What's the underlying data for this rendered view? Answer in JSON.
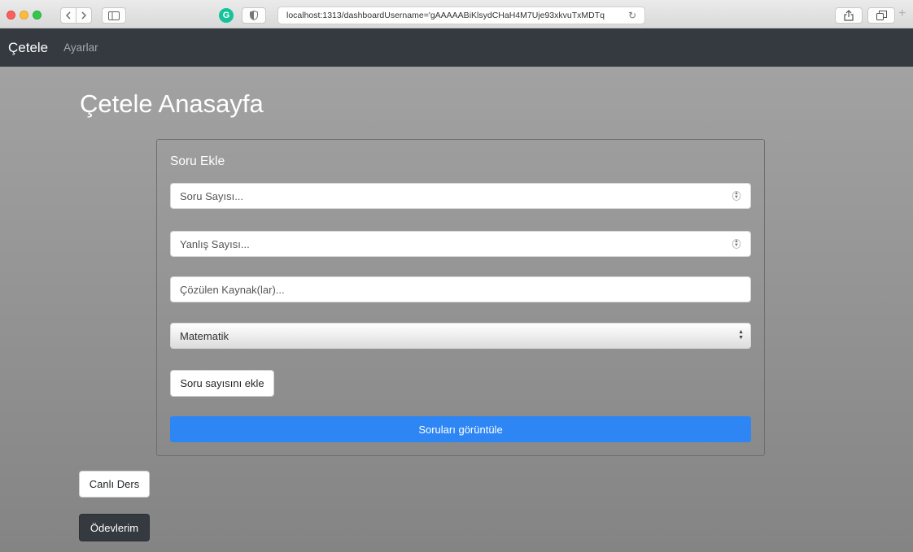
{
  "browser": {
    "url": "localhost:1313/dashboardUsername='gAAAAABiKlsydCHaH4M7Uje93xkvuTxMDTq",
    "extension_letter": "G"
  },
  "navbar": {
    "brand": "Çetele",
    "links": [
      {
        "label": "Ayarlar"
      }
    ]
  },
  "page": {
    "title": "Çetele Anasayfa"
  },
  "form": {
    "title": "Soru Ekle",
    "question_count": {
      "placeholder": "Soru Sayısı...",
      "value": ""
    },
    "wrong_count": {
      "placeholder": "Yanlış Sayısı...",
      "value": ""
    },
    "sources": {
      "placeholder": "Çözülen Kaynak(lar)...",
      "value": ""
    },
    "subject": {
      "selected": "Matematik"
    },
    "add_button": "Soru sayısını ekle",
    "view_button": "Soruları görüntüle"
  },
  "actions": {
    "live_lesson": "Canlı Ders",
    "homework": "Ödevlerim"
  },
  "colors": {
    "navbar": "#343a40",
    "primary": "#2e86f5"
  }
}
